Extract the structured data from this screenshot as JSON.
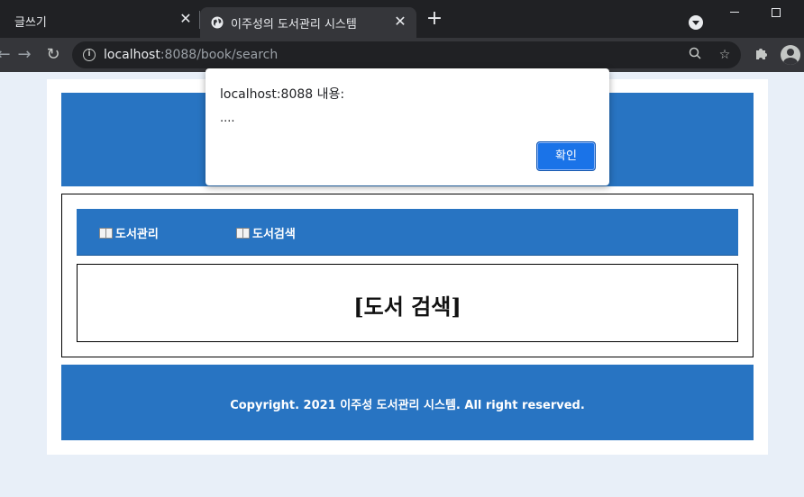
{
  "browser": {
    "tabs": [
      {
        "title": "글쓰기",
        "active": false
      },
      {
        "title": "이주성의 도서관리 시스템",
        "active": true
      }
    ],
    "url_host": "localhost",
    "url_path": ":8088/book/search",
    "icons": {
      "close": "close-icon",
      "new_tab": "plus-icon",
      "back": "back-arrow-icon",
      "forward": "forward-arrow-icon",
      "reload": "reload-icon",
      "info": "info-icon",
      "zoom": "zoom-icon",
      "bookmark": "star-icon",
      "extensions": "puzzle-icon",
      "profile": "profile-icon"
    }
  },
  "page": {
    "nav": {
      "items": [
        {
          "label": "도서관리",
          "icon": "book-icon"
        },
        {
          "label": "도서검색",
          "icon": "book-icon"
        }
      ]
    },
    "title": "[도서 검색]",
    "footer": "Copyright. 2021 이주성 도서관리 시스템. All right reserved.",
    "colors": {
      "banner": "#2874c2",
      "background": "#e8eff8"
    }
  },
  "dialog": {
    "title": "localhost:8088 내용:",
    "message": "....",
    "ok_label": "확인"
  }
}
